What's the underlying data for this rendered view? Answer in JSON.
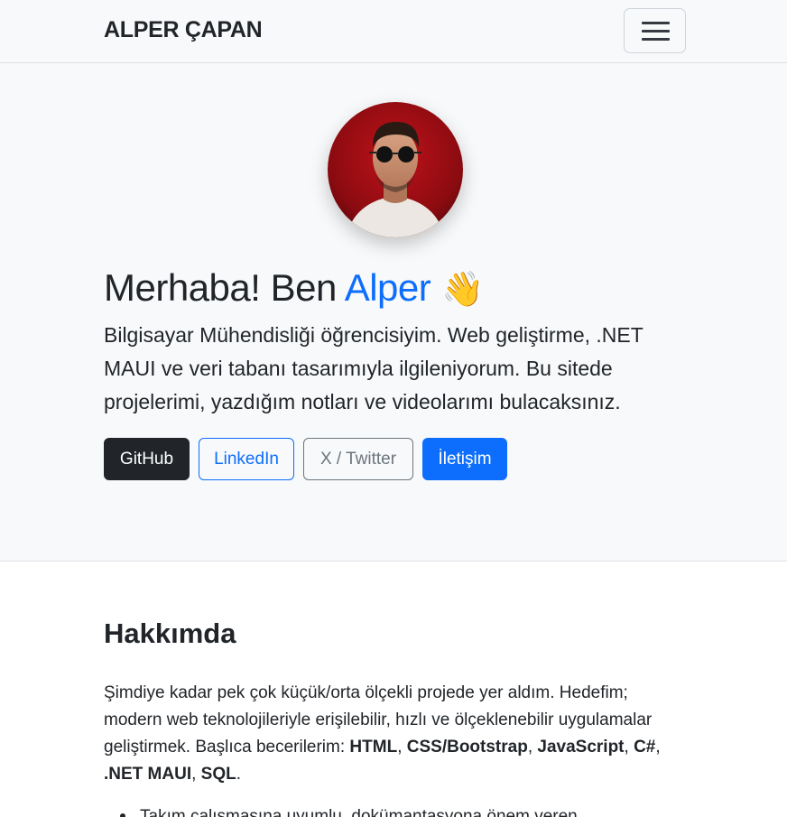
{
  "navbar": {
    "brand": "ALPER ÇAPAN",
    "toggler_icon": "hamburger-menu-icon"
  },
  "hero": {
    "avatar_alt": "profile-photo",
    "greeting_prefix": "Merhaba! Ben ",
    "greeting_name": "Alper",
    "wave_emoji": "👋",
    "lead": "Bilgisayar Mühendisliği öğrencisiyim. Web geliştirme, .NET MAUI ve veri tabanı tasarımıyla ilgileniyorum. Bu sitede projelerimi, yazdığım notları ve videolarımı bulacaksınız.",
    "buttons": {
      "github": "GitHub",
      "linkedin": "LinkedIn",
      "twitter": "X / Twitter",
      "contact": "İletişim"
    }
  },
  "about": {
    "title": "Hakkımda",
    "text_1": "Şimdiye kadar pek çok küçük/orta ölçekli projede yer aldım. Hedefim; modern web teknolojileriyle erişilebilir, hızlı ve ölçeklenebilir uygulamalar geliştirmek. Başlıca becerilerim: ",
    "skill_1": "HTML",
    "sep_1": ", ",
    "skill_2": "CSS/Bootstrap",
    "sep_2": ", ",
    "skill_3": "JavaScript",
    "sep_3": ", ",
    "skill_4": "C#",
    "sep_4": ", ",
    "skill_5": ".NET MAUI",
    "sep_5": ", ",
    "skill_6": "SQL",
    "end": ".",
    "bullet_1": "Takım çalışmasına uyumlu, dokümantasyona önem veren"
  },
  "colors": {
    "primary": "#0d6efd",
    "dark": "#212529",
    "secondary": "#6c757d",
    "light_bg": "#f8f9fa"
  }
}
